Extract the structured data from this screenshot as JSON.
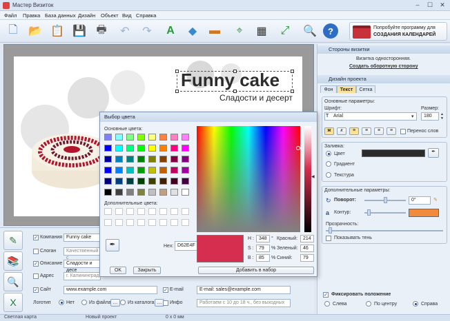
{
  "window": {
    "title": "Мастер Визиток",
    "min": "–",
    "max": "☐",
    "close": "✕"
  },
  "menu": [
    "Файл",
    "Правка",
    "База данных",
    "Дизайн",
    "Объект",
    "Вид",
    "Справка"
  ],
  "promo": {
    "line1": "Попробуйте программу для",
    "line2": "СОЗДАНИЯ КАЛЕНДАРЕЙ"
  },
  "card": {
    "heading": "Funny cake",
    "subheading": "Сладости и десерт"
  },
  "right": {
    "sides_title": "Стороны визитки",
    "sides_info": "Визитка односторонняя.",
    "sides_link": "Создать оборотную сторону",
    "design_title": "Дизайн проекта",
    "tabs": [
      "Фон",
      "Текст",
      "Сетка"
    ],
    "basic_params": "Основные параметры:",
    "font_label": "Шрифт:",
    "font_value": "Arial",
    "size_label": "Размер:",
    "size_value": "180",
    "wrap_label": "Перенос слов",
    "fill_label": "Заливка:",
    "fill_options": [
      "Цвет",
      "Градиент",
      "Текстура"
    ],
    "fill_color": "#2b2b2b",
    "extra_params": "Дополнительные параметры:",
    "rotation_label": "Поворот:",
    "rotation_value": "0°",
    "outline_label": "Контур:",
    "outline_color": "#f28a3c",
    "opacity_label": "Прозрачность:",
    "shadow_label": "Показывать тень",
    "fix_label": "Фиксировать положение",
    "align_options": [
      "Слева",
      "По центру",
      "Справа"
    ]
  },
  "dialog": {
    "title": "Выбор цвета",
    "basic_colors": "Основные цвета:",
    "extra_colors": "Дополнительные цвета:",
    "hex_label": "Hex:",
    "hex_value": "D62E4F",
    "h_label": "H :",
    "h_value": "348",
    "s_label": "S :",
    "s_value": "79",
    "b_label": "B :",
    "b_value": "85",
    "deg": "°",
    "pct1": "%",
    "pct2": "%",
    "r_label": "Красный:",
    "r_value": "214",
    "g_label": "Зеленый:",
    "g_value": "46",
    "bl_label": "Синий:",
    "bl_value": "79",
    "ok": "OK",
    "close": "Закрыть",
    "add": "Добавить в набор",
    "current_color": "#d62e4f"
  },
  "fields": {
    "company_label": "Компания",
    "company_value": "Funny cake",
    "slogan_label": "Слоган",
    "slogan_value": "Качественный с",
    "desc_label": "Описание",
    "desc_value": "Сладости и десе",
    "addr_label": "Адрес",
    "addr_value": "г. Калининград",
    "site_label": "Сайт",
    "site_value": "www.example.com",
    "email_label": "E-mail",
    "email_value": "E-mail: sales@example.com",
    "logo_label": "Логотип",
    "logo_opts": [
      "Нет",
      "Из файла",
      "Из каталога"
    ],
    "info_label": "Инфо",
    "info_value": "Работаем с 10 до 18 ч., без выходных"
  },
  "status": [
    "Светлая карта",
    "Новый проект",
    "0 x 0 мм"
  ]
}
